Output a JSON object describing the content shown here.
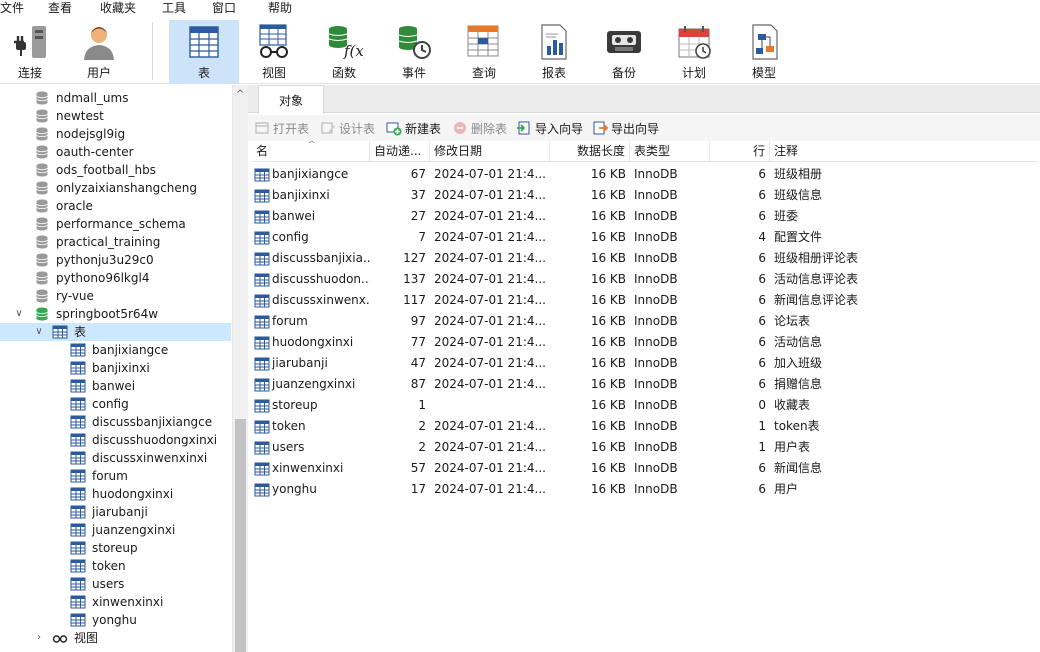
{
  "menu": [
    "文件",
    "查看",
    "收藏夹",
    "工具",
    "窗口",
    "帮助"
  ],
  "toolbar": {
    "buttons": [
      {
        "label": "连接",
        "icon": "plug-icon"
      },
      {
        "label": "用户",
        "icon": "user-icon"
      },
      {
        "label": "表",
        "icon": "table-icon",
        "active": true
      },
      {
        "label": "视图",
        "icon": "view-glasses-icon"
      },
      {
        "label": "函数",
        "icon": "function-icon"
      },
      {
        "label": "事件",
        "icon": "event-clock-icon"
      },
      {
        "label": "查询",
        "icon": "query-icon"
      },
      {
        "label": "报表",
        "icon": "report-icon"
      },
      {
        "label": "备份",
        "icon": "backup-tape-icon"
      },
      {
        "label": "计划",
        "icon": "schedule-calendar-icon"
      },
      {
        "label": "模型",
        "icon": "model-icon"
      }
    ]
  },
  "sidebar": {
    "databases": [
      "ndmall_ums",
      "newtest",
      "nodejsgl9ig",
      "oauth-center",
      "ods_football_hbs",
      "onlyzaixianshangcheng",
      "oracle",
      "performance_schema",
      "practical_training",
      "pythonju3u29c0",
      "pythono96lkgl4",
      "ry-vue",
      "springboot5r64w"
    ],
    "tables_node_label": "表",
    "tables": [
      "banjixiangce",
      "banjixinxi",
      "banwei",
      "config",
      "discussbanjixiangce",
      "discusshuodongxinxi",
      "discussxinwenxinxi",
      "forum",
      "huodongxinxi",
      "jiarubanji",
      "juanzengxinxi",
      "storeup",
      "token",
      "users",
      "xinwenxinxi",
      "yonghu"
    ],
    "views_node_label": "视图"
  },
  "tabs": {
    "objects": "对象"
  },
  "object_toolbar": {
    "open_table": "打开表",
    "design_table": "设计表",
    "new_table": "新建表",
    "delete_table": "删除表",
    "import_wizard": "导入向导",
    "export_wizard": "导出向导"
  },
  "grid": {
    "columns": {
      "name": "名",
      "auto_inc": "自动递...",
      "modified": "修改日期",
      "data_length": "数据长度",
      "table_type": "表类型",
      "rows": "行",
      "comment": "注释"
    },
    "rows": [
      {
        "name": "banjixiangce",
        "auto_inc": "67",
        "modified": "2024-07-01 21:4...",
        "data_length": "16 KB",
        "table_type": "InnoDB",
        "rows": "6",
        "comment": "班级相册"
      },
      {
        "name": "banjixinxi",
        "auto_inc": "37",
        "modified": "2024-07-01 21:4...",
        "data_length": "16 KB",
        "table_type": "InnoDB",
        "rows": "6",
        "comment": "班级信息"
      },
      {
        "name": "banwei",
        "auto_inc": "27",
        "modified": "2024-07-01 21:4...",
        "data_length": "16 KB",
        "table_type": "InnoDB",
        "rows": "6",
        "comment": "班委"
      },
      {
        "name": "config",
        "auto_inc": "7",
        "modified": "2024-07-01 21:4...",
        "data_length": "16 KB",
        "table_type": "InnoDB",
        "rows": "4",
        "comment": "配置文件"
      },
      {
        "name": "discussbanjixia...",
        "auto_inc": "127",
        "modified": "2024-07-01 21:4...",
        "data_length": "16 KB",
        "table_type": "InnoDB",
        "rows": "6",
        "comment": "班级相册评论表"
      },
      {
        "name": "discusshuodon...",
        "auto_inc": "137",
        "modified": "2024-07-01 21:4...",
        "data_length": "16 KB",
        "table_type": "InnoDB",
        "rows": "6",
        "comment": "活动信息评论表"
      },
      {
        "name": "discussxinwenx...",
        "auto_inc": "117",
        "modified": "2024-07-01 21:4...",
        "data_length": "16 KB",
        "table_type": "InnoDB",
        "rows": "6",
        "comment": "新闻信息评论表"
      },
      {
        "name": "forum",
        "auto_inc": "97",
        "modified": "2024-07-01 21:4...",
        "data_length": "16 KB",
        "table_type": "InnoDB",
        "rows": "6",
        "comment": "论坛表"
      },
      {
        "name": "huodongxinxi",
        "auto_inc": "77",
        "modified": "2024-07-01 21:4...",
        "data_length": "16 KB",
        "table_type": "InnoDB",
        "rows": "6",
        "comment": "活动信息"
      },
      {
        "name": "jiarubanji",
        "auto_inc": "47",
        "modified": "2024-07-01 21:4...",
        "data_length": "16 KB",
        "table_type": "InnoDB",
        "rows": "6",
        "comment": "加入班级"
      },
      {
        "name": "juanzengxinxi",
        "auto_inc": "87",
        "modified": "2024-07-01 21:4...",
        "data_length": "16 KB",
        "table_type": "InnoDB",
        "rows": "6",
        "comment": "捐赠信息"
      },
      {
        "name": "storeup",
        "auto_inc": "1",
        "modified": "",
        "data_length": "16 KB",
        "table_type": "InnoDB",
        "rows": "0",
        "comment": "收藏表"
      },
      {
        "name": "token",
        "auto_inc": "2",
        "modified": "2024-07-01 21:4...",
        "data_length": "16 KB",
        "table_type": "InnoDB",
        "rows": "1",
        "comment": "token表"
      },
      {
        "name": "users",
        "auto_inc": "2",
        "modified": "2024-07-01 21:4...",
        "data_length": "16 KB",
        "table_type": "InnoDB",
        "rows": "1",
        "comment": "用户表"
      },
      {
        "name": "xinwenxinxi",
        "auto_inc": "57",
        "modified": "2024-07-01 21:4...",
        "data_length": "16 KB",
        "table_type": "InnoDB",
        "rows": "6",
        "comment": "新闻信息"
      },
      {
        "name": "yonghu",
        "auto_inc": "17",
        "modified": "2024-07-01 21:4...",
        "data_length": "16 KB",
        "table_type": "InnoDB",
        "rows": "6",
        "comment": "用户"
      }
    ]
  },
  "colors": {
    "selection": "#cce8ff",
    "active_tool": "#cde3f7",
    "db_icon": "#9a9a9a",
    "db_open_icon": "#3aa655",
    "table_icon": "#2b5a9e"
  }
}
